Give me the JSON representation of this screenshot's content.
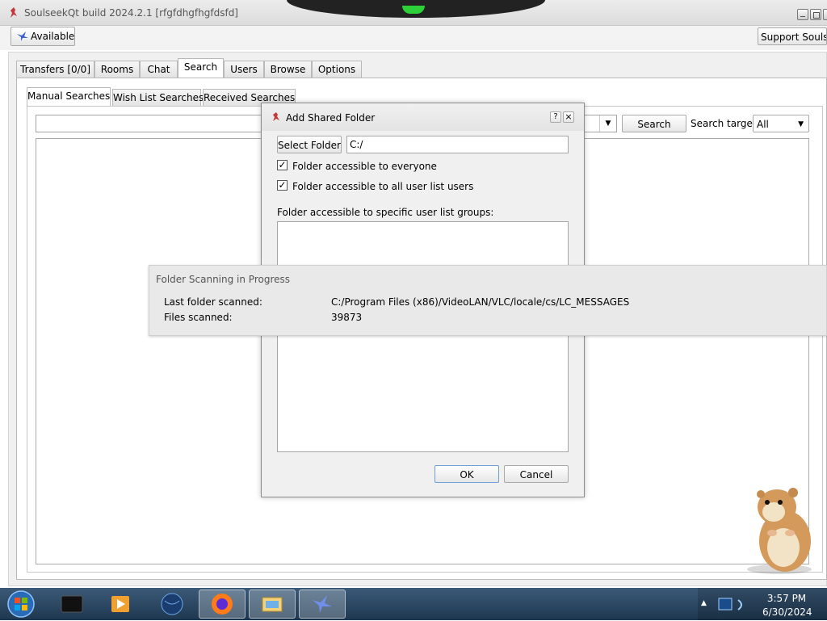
{
  "window": {
    "title": "SoulseekQt build 2024.2.1 [rfgfdhgfhgfdsfd]"
  },
  "toolbar": {
    "status_label": "Available",
    "support_label": "Support Soulseek"
  },
  "tabs": [
    "Transfers [0/0]",
    "Rooms",
    "Chat",
    "Search",
    "Users",
    "Browse",
    "Options"
  ],
  "subtabs": [
    "Manual Searches",
    "Wish List Searches",
    "Received Searches"
  ],
  "search": {
    "query": "",
    "button_label": "Search",
    "target_label": "Search target:",
    "target_value": "All"
  },
  "dialog": {
    "title": "Add Shared Folder",
    "help_glyph": "?",
    "close_glyph": "×",
    "select_folder_label": "Select Folder",
    "folder_path": "C:/",
    "checkbox_everyone": "Folder accessible to everyone",
    "checkbox_userlist": "Folder accessible to all user list users",
    "groups_label": "Folder accessible to specific user list groups:",
    "ok_label": "OK",
    "cancel_label": "Cancel",
    "everyone_checked": true,
    "userlist_checked": true
  },
  "scan": {
    "title": "Folder Scanning in Progress",
    "last_folder_label": "Last folder scanned:",
    "last_folder_value": "C:/Program Files (x86)/VideoLAN/VLC/locale/cs/LC_MESSAGES",
    "files_label": "Files scanned:",
    "files_value": "39873"
  },
  "taskbar": {
    "time": "3:57 PM",
    "date": "6/30/2024"
  },
  "icons": [
    "soulseek-bird-icon",
    "start-orb-icon",
    "terminal-icon",
    "media-player-icon",
    "globe-icon",
    "firefox-icon",
    "file-explorer-icon",
    "soulseek-taskbar-icon",
    "network-icon",
    "hamster-mascot"
  ],
  "colors": {
    "taskbar": "#1e3750",
    "notch_led": "#2ed03a",
    "dialog_bg": "#f0f0f0"
  }
}
